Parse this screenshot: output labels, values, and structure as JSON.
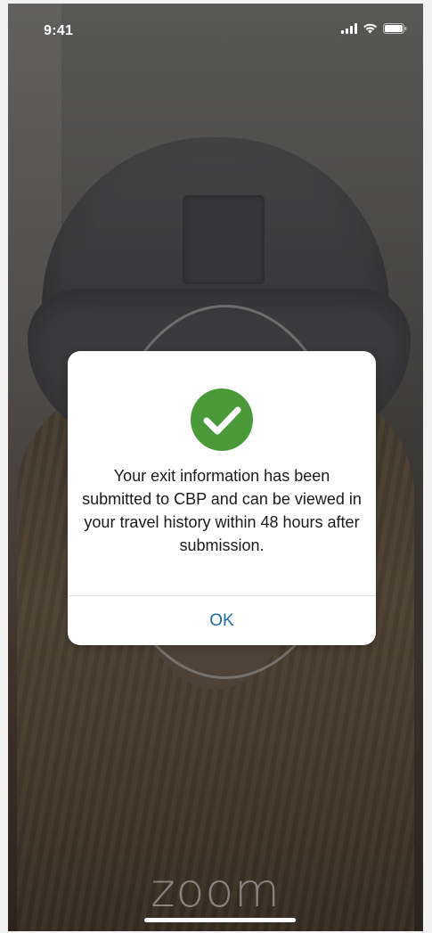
{
  "status_bar": {
    "time": "9:41",
    "icons": [
      "signal-icon",
      "wifi-icon",
      "battery-icon"
    ]
  },
  "dialog": {
    "icon": "check-circle-icon",
    "icon_color": "#4a9a3a",
    "message": "Your exit information has been submitted to CBP and can be viewed in your travel history within 48 hours after submission.",
    "ok_label": "OK",
    "ok_color": "#1d6fa5"
  },
  "background": {
    "logo_text": "zoom"
  }
}
